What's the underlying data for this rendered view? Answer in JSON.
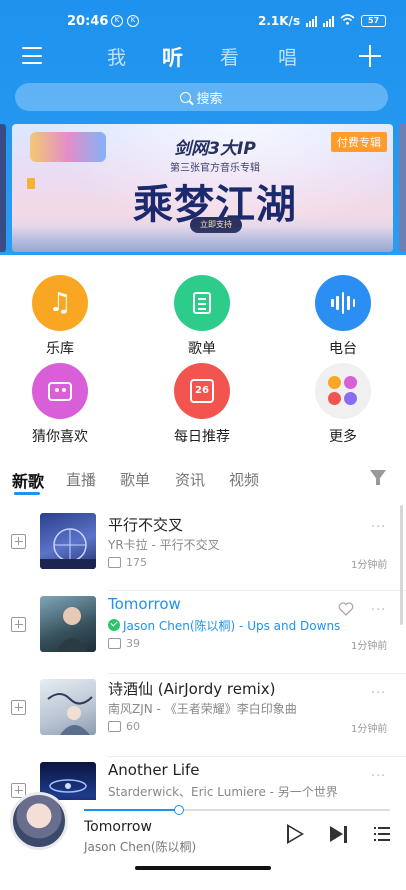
{
  "status_bar": {
    "time": "20:46",
    "speed": "2.1K/s",
    "battery": "57"
  },
  "top_nav": {
    "tabs": [
      "我",
      "听",
      "看",
      "唱"
    ],
    "active_tab": "听"
  },
  "search": {
    "placeholder": "搜索"
  },
  "banner": {
    "title": "剑网3大IP",
    "subtitle": "第三张官方音乐专辑",
    "main_text": "乘梦江湖",
    "button": "立即支持",
    "tag": "付费专辑"
  },
  "categories": [
    {
      "label": "乐库",
      "icon": "music-note-icon",
      "color": "#f9a623"
    },
    {
      "label": "歌单",
      "icon": "playlist-icon",
      "color": "#2ecc8a"
    },
    {
      "label": "电台",
      "icon": "radio-wave-icon",
      "color": "#2a8ef3"
    },
    {
      "label": "猜你喜欢",
      "icon": "tv-icon",
      "color": "#d85fd8"
    },
    {
      "label": "每日推荐",
      "icon": "calendar-icon",
      "color": "#f4544f"
    },
    {
      "label": "更多",
      "icon": "more-grid-icon",
      "color": "#f0f0f0"
    }
  ],
  "daily_date": "26",
  "content_tabs": [
    "新歌",
    "直播",
    "歌单",
    "资讯",
    "视频"
  ],
  "active_content_tab": "新歌",
  "songs": [
    {
      "title": "平行不交叉",
      "artist": "YR卡拉 - 平行不交叉",
      "comments": "175",
      "time": "1分钟前"
    },
    {
      "title": "Tomorrow",
      "artist": "Jason Chen(陈以桐) - Ups and Downs",
      "comments": "39",
      "time": "1分钟前"
    },
    {
      "title": "诗酒仙 (AirJordy remix)",
      "artist": "南风ZJN - 《王者荣耀》李白印象曲",
      "comments": "60",
      "time": "1分钟前"
    },
    {
      "title": "Another Life",
      "artist": "Starderwick、Eric Lumiere - 另一个世界",
      "comments": "",
      "time": ""
    }
  ],
  "player": {
    "title": "Tomorrow",
    "artist": "Jason Chen(陈以桐)",
    "progress": 0.31
  },
  "colors": {
    "accent": "#1e92ee",
    "vip_green": "#2cc46b",
    "banner_tag": "#ff9c2a"
  }
}
